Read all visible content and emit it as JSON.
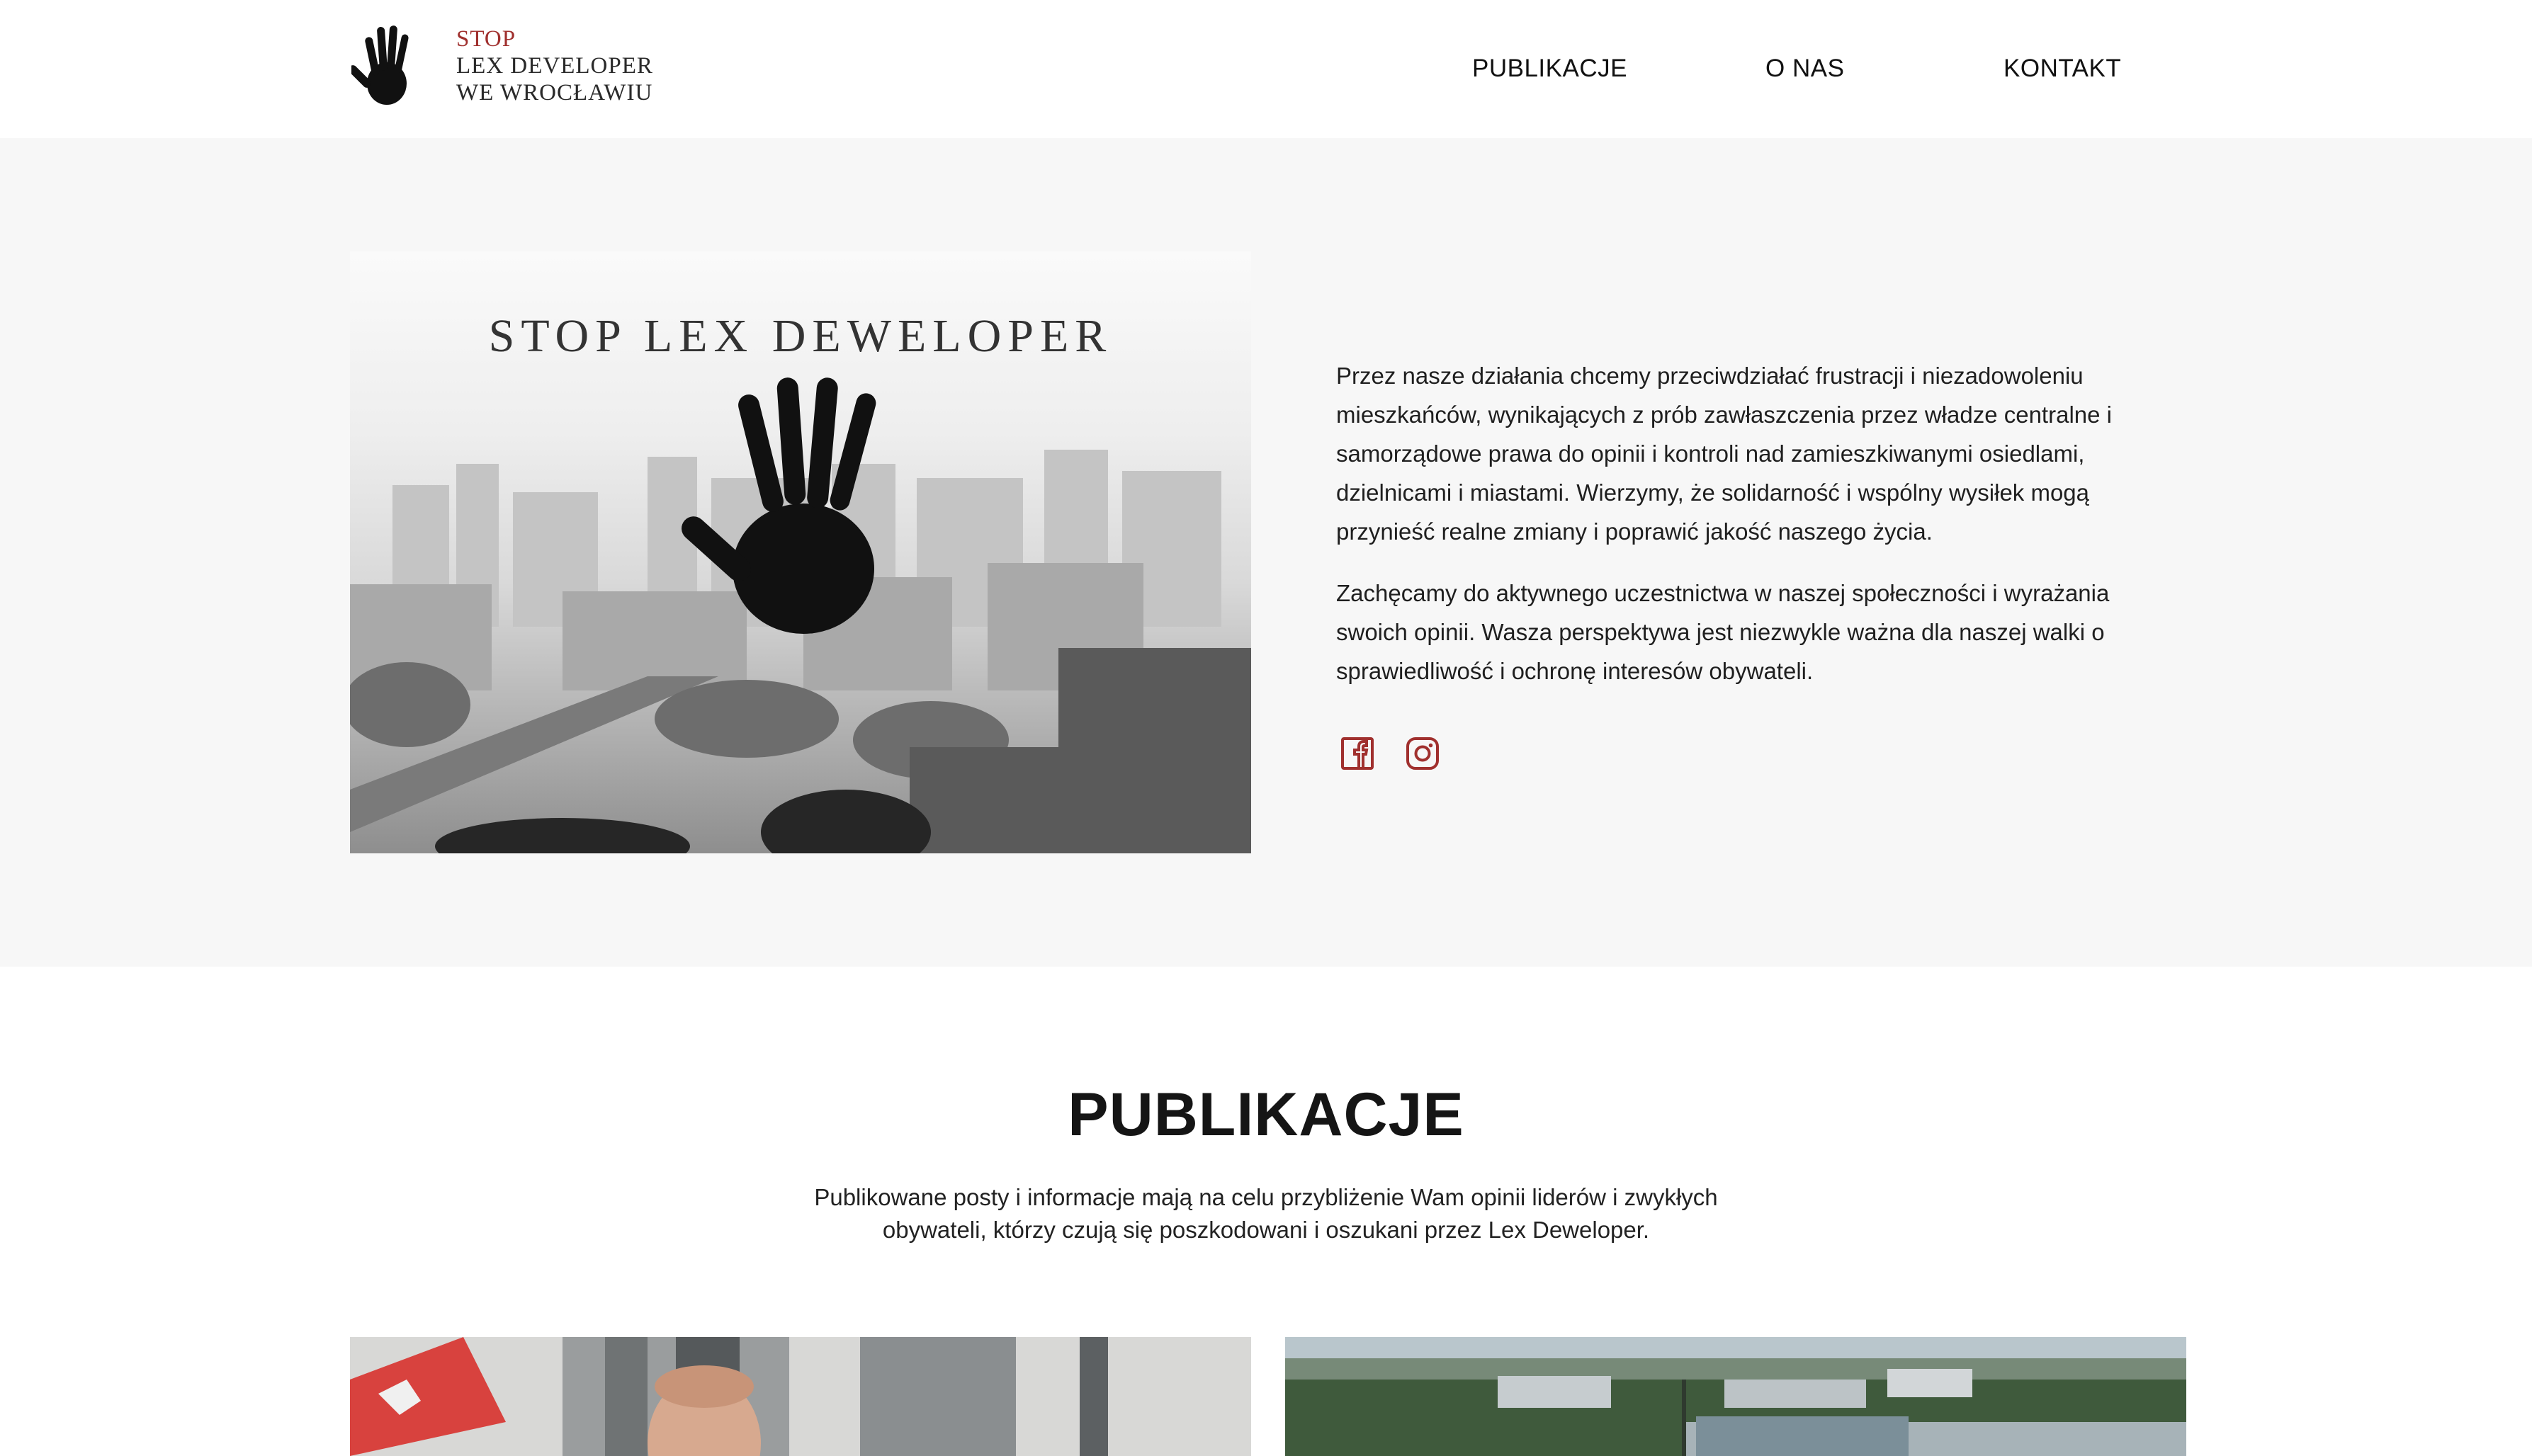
{
  "header": {
    "logo": {
      "line1": "STOP",
      "line2": "LEX DEVELOPER",
      "line3": "WE WROCŁAWIU",
      "icon": "handprint-icon"
    },
    "nav": [
      {
        "label": "PUBLIKACJE"
      },
      {
        "label": "O NAS"
      },
      {
        "label": "KONTAKT"
      }
    ]
  },
  "hero": {
    "image_title": "STOP LEX DEWELOPER",
    "paragraphs": [
      "Przez nasze działania chcemy przeciwdziałać frustracji i niezadowoleniu mieszkańców, wynikających z prób zawłaszczenia przez władze centralne i samorządowe prawa do opinii i kontroli nad zamieszkiwanymi osiedlami, dzielnicami i miastami. Wierzymy, że solidarność i wspólny wysiłek mogą przynieść realne zmiany i poprawić jakość naszego życia.",
      "Zachęcamy do aktywnego uczestnictwa w naszej społeczności i wyrażania swoich opinii. Wasza perspektywa jest niezwykle ważna dla naszej walki o sprawiedliwość i ochronę interesów obywateli."
    ],
    "socials": [
      {
        "icon": "facebook-icon"
      },
      {
        "icon": "instagram-icon"
      }
    ]
  },
  "publications": {
    "title": "PUBLIKACJE",
    "description": "Publikowane posty i informacje mają na celu przybliżenie Wam opinii liderów i zwykłych obywateli, którzy czują się poszkodowani i oszukani przez Lex Deweloper."
  },
  "colors": {
    "accent": "#a0302e",
    "hero_bg": "#f7f7f7",
    "text": "#1a1a1a"
  }
}
